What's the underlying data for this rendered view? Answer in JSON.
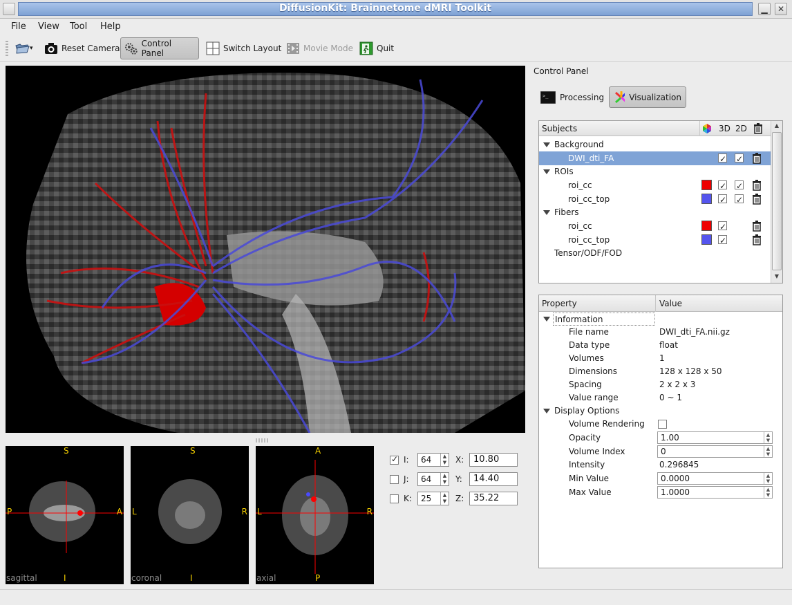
{
  "window": {
    "title": "DiffusionKit: Brainnetome dMRI Toolkit"
  },
  "menu": [
    "File",
    "View",
    "Tool",
    "Help"
  ],
  "toolbar": {
    "reset_camera": "Reset Camera",
    "control_panel": "Control Panel",
    "switch_layout": "Switch Layout",
    "movie_mode": "Movie Mode",
    "quit": "Quit"
  },
  "slices": {
    "sagittal": {
      "name": "sagittal",
      "top": "S",
      "bottom": "I",
      "left": "P",
      "right": "A"
    },
    "coronal": {
      "name": "coronal",
      "top": "S",
      "bottom": "I",
      "left": "L",
      "right": "R"
    },
    "axial": {
      "name": "axial",
      "top": "A",
      "bottom": "P",
      "left": "L",
      "right": "R"
    }
  },
  "coords": [
    {
      "checked": true,
      "label": "I:",
      "index": "64",
      "axis": "X:",
      "value": "10.80"
    },
    {
      "checked": false,
      "label": "J:",
      "index": "64",
      "axis": "Y:",
      "value": "14.40"
    },
    {
      "checked": false,
      "label": "K:",
      "index": "25",
      "axis": "Z:",
      "value": "35.22"
    }
  ],
  "control_panel": {
    "title": "Control Panel",
    "processing": "Processing",
    "visualization": "Visualization"
  },
  "subjects": {
    "header": "Subjects",
    "col_3d": "3D",
    "col_2d": "2D",
    "background": "Background",
    "dwi": "DWI_dti_FA",
    "rois": "ROIs",
    "roi_cc": "roi_cc",
    "roi_cc_top": "roi_cc_top",
    "fibers": "Fibers",
    "fib_cc": "roi_cc",
    "fib_cc_top": "roi_cc_top",
    "tensor": "Tensor/ODF/FOD",
    "red": "#ee0000",
    "blue": "#5555ee"
  },
  "properties": {
    "col_property": "Property",
    "col_value": "Value",
    "information": "Information",
    "file_name_label": "File name",
    "file_name": "DWI_dti_FA.nii.gz",
    "data_type_label": "Data type",
    "data_type": "float",
    "volumes_label": "Volumes",
    "volumes": "1",
    "dimensions_label": "Dimensions",
    "dimensions": "128 x 128 x 50",
    "spacing_label": "Spacing",
    "spacing": "2 x 2 x 3",
    "value_range_label": "Value range",
    "value_range": "0 ~ 1",
    "display_options": "Display Options",
    "volume_rendering_label": "Volume Rendering",
    "opacity_label": "Opacity",
    "opacity": "1.00",
    "volume_index_label": "Volume Index",
    "volume_index": "0",
    "intensity_label": "Intensity",
    "intensity": "0.296845",
    "min_value_label": "Min Value",
    "min_value": "0.0000",
    "max_value_label": "Max Value",
    "max_value": "1.0000"
  }
}
